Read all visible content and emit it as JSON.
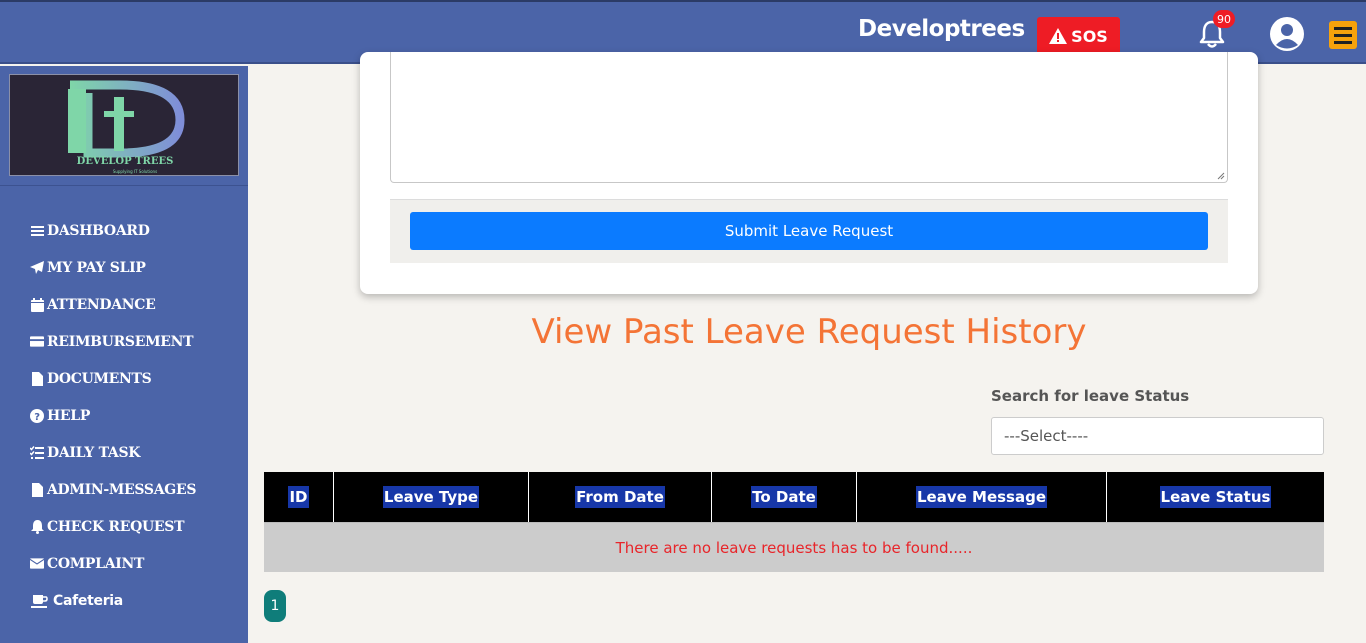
{
  "header": {
    "brand": "Developtrees",
    "sos_label": "SOS",
    "notification_count": "90"
  },
  "sidebar": {
    "logo_text": "DEVELOP TREES",
    "logo_tagline": "Supplying IT Solutions",
    "items": [
      {
        "label": "DASHBOARD",
        "icon": "bars-icon"
      },
      {
        "label": "MY PAY SLIP",
        "icon": "paper-plane-icon"
      },
      {
        "label": "ATTENDANCE",
        "icon": "calendar-icon"
      },
      {
        "label": "REIMBURSEMENT",
        "icon": "credit-card-icon"
      },
      {
        "label": "DOCUMENTS",
        "icon": "file-icon"
      },
      {
        "label": "HELP",
        "icon": "question-circle-icon"
      },
      {
        "label": "DAILY TASK",
        "icon": "task-list-icon"
      },
      {
        "label": "ADMIN-MESSAGES",
        "icon": "file-icon"
      },
      {
        "label": "CHECK REQUEST",
        "icon": "bell-icon"
      },
      {
        "label": "COMPLAINT",
        "icon": "envelope-icon"
      },
      {
        "label": "Cafeteria",
        "icon": "coffee-icon"
      }
    ]
  },
  "form": {
    "submit_label": "Submit Leave Request"
  },
  "history": {
    "title": "View Past Leave Request History",
    "search_label": "Search for leave Status",
    "select_value": "---Select----",
    "columns": [
      "ID",
      "Leave Type",
      "From Date",
      "To Date",
      "Leave Message",
      "Leave Status"
    ],
    "empty_message": "There are no leave requests has to be found.....",
    "current_page": "1"
  },
  "colors": {
    "header_bg": "#4b64a8",
    "sos": "#ee1c25",
    "submit": "#0b7bff",
    "title": "#f47436",
    "empty_text": "#e8252a",
    "page_btn": "#0f7d7a"
  }
}
